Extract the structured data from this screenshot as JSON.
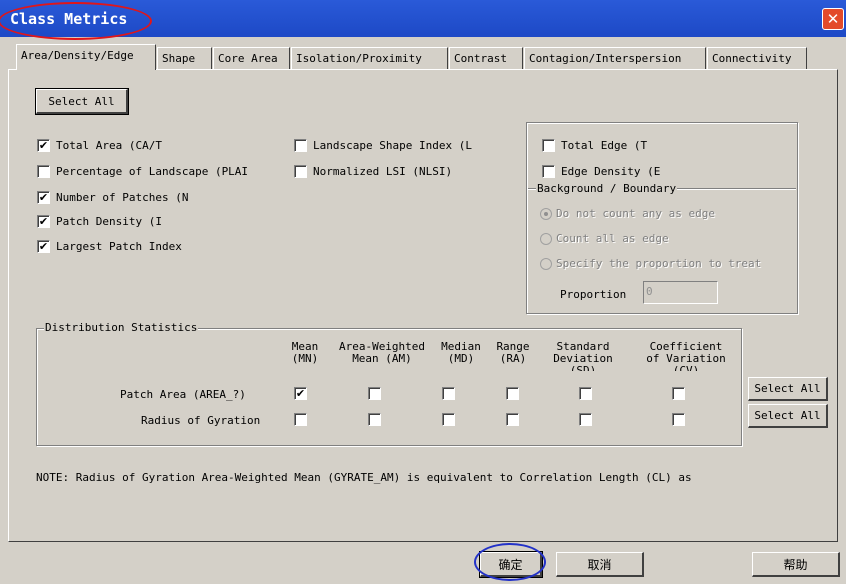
{
  "window": {
    "title": "Class Metrics",
    "close_glyph": "✕"
  },
  "tabs": [
    {
      "label": "Area/Density/Edge"
    },
    {
      "label": "Shape"
    },
    {
      "label": "Core Area"
    },
    {
      "label": "Isolation/Proximity"
    },
    {
      "label": "Contrast"
    },
    {
      "label": "Contagion/Interspersion"
    },
    {
      "label": "Connectivity"
    }
  ],
  "select_all_top": "Select All",
  "check_mark": "✔",
  "metrics_left": [
    {
      "label": "Total Area  (CA/T",
      "checked": true
    },
    {
      "label": "Percentage of Landscape  (PLAI",
      "checked": false
    },
    {
      "label": "Number of Patches  (N",
      "checked": true
    },
    {
      "label": "Patch Density  (I",
      "checked": true
    },
    {
      "label": "Largest Patch Index",
      "checked": true
    }
  ],
  "metrics_middle": [
    {
      "label": "Landscape Shape Index  (L",
      "checked": false
    },
    {
      "label": "Normalized LSI (NLSI)",
      "checked": false
    }
  ],
  "edge_group": {
    "total_edge": "Total Edge  (T",
    "edge_density": "Edge Density  (E",
    "background_title": "Background / Boundary",
    "options": [
      {
        "label": "Do not count any as edge",
        "selected": true
      },
      {
        "label": "Count all as edge",
        "selected": false
      },
      {
        "label": "Specify the proportion to treat",
        "selected": false
      }
    ],
    "proportion_label": "Proportion",
    "proportion_value": "0"
  },
  "distribution": {
    "title": "Distribution Statistics",
    "columns": [
      {
        "label": "Mean\n(MN)"
      },
      {
        "label": "Area-Weighted\nMean (AM)"
      },
      {
        "label": "Median\n(MD)"
      },
      {
        "label": "Range\n(RA)"
      },
      {
        "label": "Standard\nDeviation\n(SD)"
      },
      {
        "label": "Coefficient\nof Variation\n(CV)"
      }
    ],
    "rows": [
      {
        "label": "Patch Area (AREA_?)",
        "checks": [
          true,
          false,
          false,
          false,
          false,
          false
        ],
        "select_all": "Select All"
      },
      {
        "label": "Radius of Gyration",
        "checks": [
          false,
          false,
          false,
          false,
          false,
          false
        ],
        "select_all": "Select All"
      }
    ]
  },
  "note": "NOTE: Radius of Gyration Area-Weighted Mean (GYRATE_AM) is equivalent to Correlation Length (CL) as",
  "footer": {
    "ok": "确定",
    "cancel": "取消",
    "help": "帮助"
  }
}
